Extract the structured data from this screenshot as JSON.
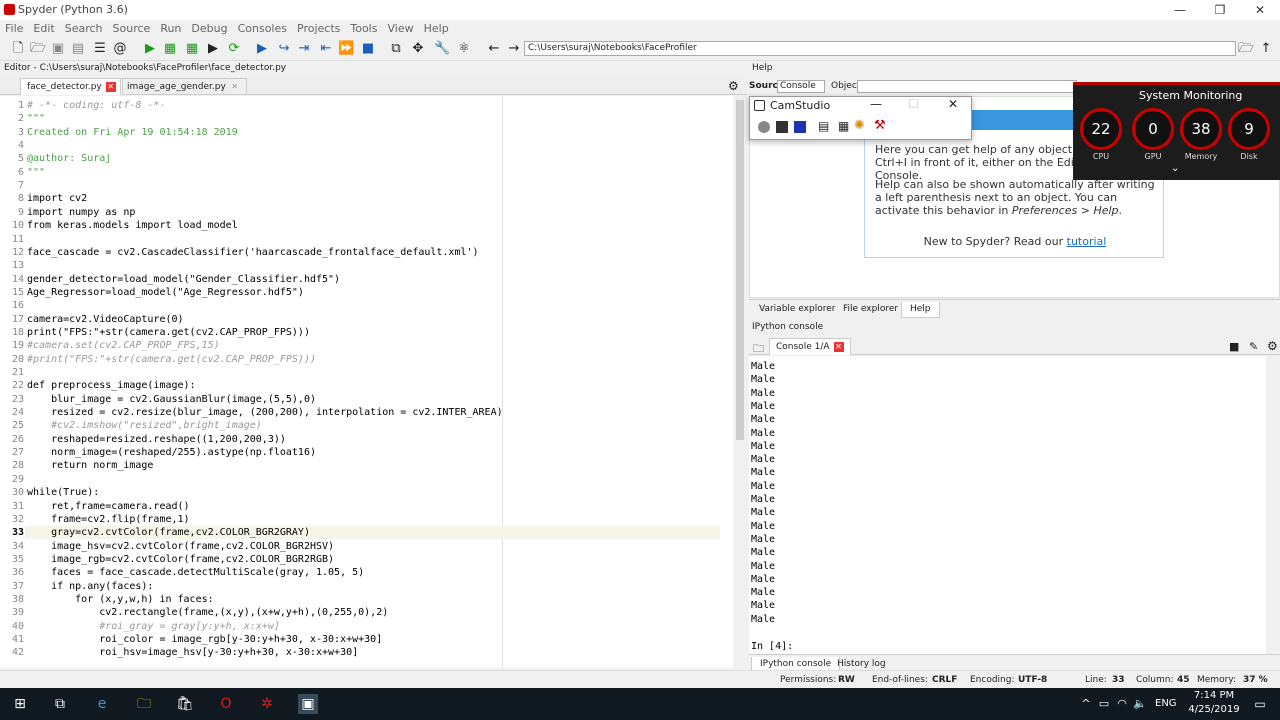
{
  "window": {
    "title": "Spyder (Python 3.6)",
    "controls": [
      "—",
      "❐",
      "✕"
    ]
  },
  "menu": [
    "File",
    "Edit",
    "Search",
    "Source",
    "Run",
    "Debug",
    "Consoles",
    "Projects",
    "Tools",
    "View",
    "Help"
  ],
  "toolbar": {
    "path": "C:\\Users\\suraj\\Notebooks\\FaceProfiler"
  },
  "editor": {
    "header": "Editor - C:\\Users\\suraj\\Notebooks\\FaceProfiler\\face_detector.py",
    "tabs": [
      "face_detector.py",
      "image_age_gender.py"
    ],
    "current_line": 33,
    "lines": [
      "# -*- coding: utf-8 -*-",
      "\"\"\"",
      "Created on Fri Apr 19 01:54:18 2019",
      "",
      "@author: Suraj",
      "\"\"\"",
      "",
      "import cv2",
      "import numpy as np",
      "from keras.models import load_model",
      "",
      "face_cascade = cv2.CascadeClassifier('haarcascade_frontalface_default.xml')",
      "",
      "gender_detector=load_model(\"Gender_Classifier.hdf5\")",
      "Age_Regressor=load_model(\"Age_Regressor.hdf5\")",
      "",
      "camera=cv2.VideoCapture(0)",
      "print(\"FPS:\"+str(camera.get(cv2.CAP_PROP_FPS)))",
      "#camera.set(cv2.CAP_PROP_FPS,15)",
      "#print(\"FPS:\"+str(camera.get(cv2.CAP_PROP_FPS)))",
      "",
      "def preprocess_image(image):",
      "    blur_image = cv2.GaussianBlur(image,(5,5),0)",
      "    resized = cv2.resize(blur_image, (200,200), interpolation = cv2.INTER_AREA)",
      "    #cv2.imshow(\"resized\",bright_image)",
      "    reshaped=resized.reshape((1,200,200,3))",
      "    norm_image=(reshaped/255).astype(np.float16)",
      "    return norm_image",
      "",
      "while(True):",
      "    ret,frame=camera.read()",
      "    frame=cv2.flip(frame,1)",
      "    gray=cv2.cvtColor(frame,cv2.COLOR_BGR2GRAY)",
      "    image_hsv=cv2.cvtColor(frame,cv2.COLOR_BGR2HSV)",
      "    image_rgb=cv2.cvtColor(frame,cv2.COLOR_BGR2RGB)",
      "    faces = face_cascade.detectMultiScale(gray, 1.05, 5)",
      "    if np.any(faces):",
      "        for (x,y,w,h) in faces:",
      "            cv2.rectangle(frame,(x,y),(x+w,y+h),(0,255,0),2)",
      "            #roi_gray = gray[y:y+h, x:x+w]",
      "            roi_color = image_rgb[y-30:y+h+30, x-30:x+w+30]",
      "            roi_hsv=image_hsv[y-30:y+h+30, x-30:x+w+30]"
    ]
  },
  "help": {
    "header": "Help",
    "source_label": "Source",
    "source_value": "Console",
    "object_label": "Object",
    "p1": "Here you can get help of any object by pressing Ctrl+I in front of it, either on the Editor or the Console.",
    "p2a": "Help can also be shown automatically after writing a left parenthesis next to an object. You can activate this behavior in ",
    "p2b": "Preferences > Help",
    "p2c": ".",
    "new": "New to Spyder? Read our ",
    "link": "tutorial",
    "tabs": [
      "Variable explorer",
      "File explorer",
      "Help"
    ]
  },
  "console": {
    "header": "IPython console",
    "tab": "Console 1/A",
    "output": [
      "Male",
      "Male",
      "Male",
      "Male",
      "Male",
      "Male",
      "Male",
      "Male",
      "Male",
      "Male",
      "Male",
      "Male",
      "Male",
      "Male",
      "Male",
      "Male",
      "Male",
      "Male",
      "Male",
      "Male"
    ],
    "prompt": "In [4]:",
    "tabs": [
      "IPython console",
      "History log"
    ]
  },
  "status": {
    "permissions_label": "Permissions:",
    "permissions": "RW",
    "eol_label": "End-of-lines:",
    "eol": "CRLF",
    "enc_label": "Encoding:",
    "enc": "UTF-8",
    "line_label": "Line:",
    "line": "33",
    "col_label": "Column:",
    "col": "45",
    "mem_label": "Memory:",
    "mem": "37 %"
  },
  "camstudio": {
    "title": "CamStudio"
  },
  "sysmon": {
    "title": "System Monitoring",
    "gauges": [
      {
        "value": "22",
        "label": "CPU"
      },
      {
        "value": "0",
        "label": "GPU"
      },
      {
        "value": "38",
        "label": "Memory"
      },
      {
        "value": "9",
        "label": "Disk"
      }
    ]
  },
  "taskbar": {
    "lang": "ENG",
    "time": "7:14 PM",
    "date": "4/25/2019"
  },
  "colors": {
    "accent": "#3a96dd",
    "monitor_red": "#b30000",
    "string": "#4ba045",
    "keyword": "#0000a0"
  }
}
